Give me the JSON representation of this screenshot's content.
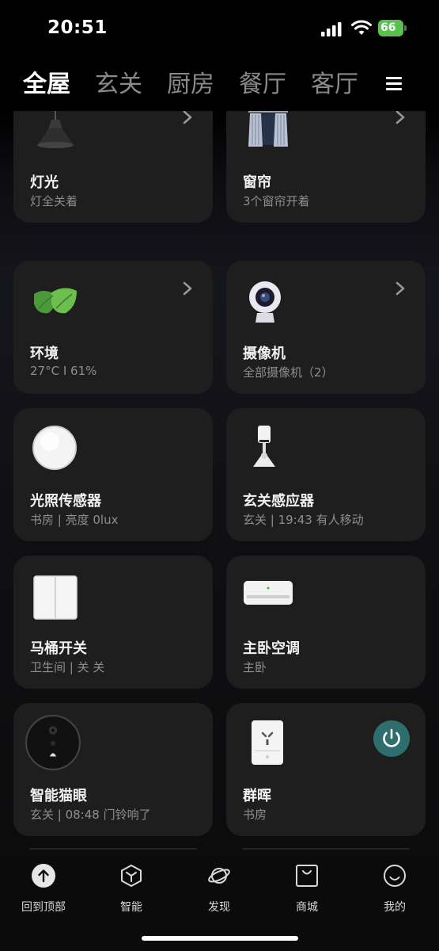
{
  "status_bar": {
    "time": "20:51",
    "battery": "66"
  },
  "tabs": [
    {
      "label": "全屋",
      "active": true
    },
    {
      "label": "玄关"
    },
    {
      "label": "厨房"
    },
    {
      "label": "餐厅"
    },
    {
      "label": "客厅"
    }
  ],
  "cards": [
    {
      "title": "灯光",
      "subtitle": "灯全关着",
      "icon": "pendant-lamp-icon",
      "has_arrow": true
    },
    {
      "title": "窗帘",
      "subtitle": "3个窗帘开着",
      "icon": "curtain-icon",
      "has_arrow": true
    },
    {
      "title": "环境",
      "subtitle": "27°C  I  61%",
      "icon": "leaf-icon",
      "has_arrow": true
    },
    {
      "title": "摄像机",
      "subtitle": "全部摄像机（2）",
      "icon": "camera-icon",
      "has_arrow": true
    },
    {
      "title": "光照传感器",
      "subtitle": "书房 | 亮度 0lux",
      "icon": "light-sensor-icon"
    },
    {
      "title": "玄关感应器",
      "subtitle": "玄关 | 19:43 有人移动",
      "icon": "motion-sensor-icon"
    },
    {
      "title": "马桶开关",
      "subtitle": "卫生间 | 关 关",
      "icon": "wall-switch-icon"
    },
    {
      "title": "主卧空调",
      "subtitle": "主卧",
      "icon": "air-conditioner-icon"
    },
    {
      "title": "智能猫眼",
      "subtitle": "玄关 | 08:48 门铃响了",
      "icon": "smart-peephole-icon"
    },
    {
      "title": "群晖",
      "subtitle": "书房",
      "icon": "smart-plug-icon",
      "power_on": true
    }
  ],
  "bottom_nav": [
    {
      "label": "回到顶部",
      "icon": "arrow-up-icon"
    },
    {
      "label": "智能",
      "icon": "cube-icon"
    },
    {
      "label": "发现",
      "icon": "planet-icon"
    },
    {
      "label": "商城",
      "icon": "shopping-bag-icon"
    },
    {
      "label": "我的",
      "icon": "smiley-icon"
    }
  ],
  "colors": {
    "background": "#000000",
    "card": "#1e1e1e",
    "power_button": "#2e6e6e",
    "battery": "#5ac14f"
  }
}
